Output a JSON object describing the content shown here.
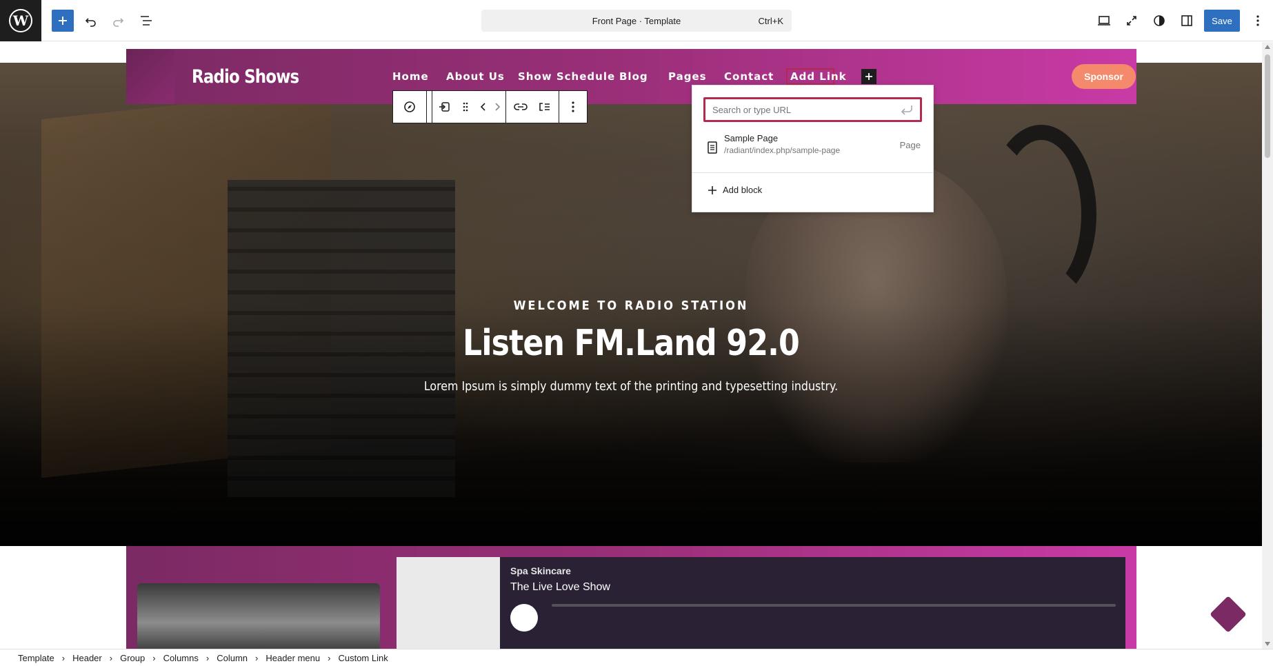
{
  "toolbar": {
    "document_title": "Front Page · Template",
    "shortcut": "Ctrl+K",
    "save_label": "Save"
  },
  "header": {
    "site_title": "Radio Shows",
    "nav": [
      "Home",
      "About Us",
      "Show Schedule",
      "Blog",
      "Pages",
      "Contact",
      "Add Link"
    ],
    "sponsor_label": "Sponsor"
  },
  "hero": {
    "kicker": "WELCOME TO RADIO STATION",
    "title": "Listen FM.Land 92.0",
    "subtitle": "Lorem Ipsum is simply dummy text of the printing and typesetting industry."
  },
  "link_popover": {
    "placeholder": "Search or type URL",
    "suggestion_title": "Sample Page",
    "suggestion_path": "/radiant/index.php/sample-page",
    "suggestion_type": "Page",
    "add_block_label": "Add block"
  },
  "player": {
    "label": "Spa Skincare",
    "show": "The Live Love Show"
  },
  "breadcrumb": [
    "Template",
    "Header",
    "Group",
    "Columns",
    "Column",
    "Header menu",
    "Custom Link"
  ],
  "colors": {
    "accent": "#2f6fbf",
    "header_gradient_start": "#7b2a63",
    "header_gradient_end": "#c93aa6",
    "sponsor": "#f48a6b",
    "focus": "#b22a4f"
  }
}
